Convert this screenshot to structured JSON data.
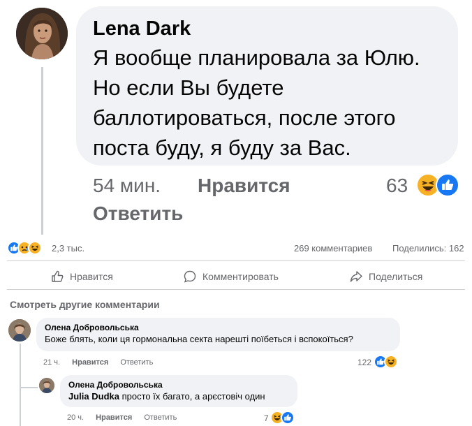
{
  "top_comment": {
    "author": "Lena Dark",
    "text": "Я вообще планировала за Юлю. Но если Вы будете баллотироваться, после этого поста буду, я буду за Вас.",
    "time": "54 мин.",
    "like_label": "Нравится",
    "reply_label": "Ответить",
    "reaction_count": "63",
    "reactions": [
      "haha-icon",
      "like-icon"
    ]
  },
  "post_summary": {
    "reaction_count": "2,3 тыс.",
    "comments": "269 комментариев",
    "shares": "Поделились: 162",
    "reactions": [
      "like-icon",
      "sad-icon",
      "haha-icon"
    ]
  },
  "actions": {
    "like": "Нравится",
    "comment": "Комментировать",
    "share": "Поделиться"
  },
  "view_more": "Смотреть другие комментарии",
  "comments": [
    {
      "author": "Олена Добровольська",
      "text": "Боже блять, коли ця гормональна секта нарешті поїбеться і вспокоїться?",
      "time": "21 ч.",
      "like_label": "Нравится",
      "reply_label": "Ответить",
      "reaction_count": "122",
      "reactions": [
        "like-icon",
        "haha-icon"
      ]
    },
    {
      "author": "Олена Добровольська",
      "mention": "Julia Dudka",
      "text": " просто їх багато, а арєстовіч один",
      "time": "20 ч.",
      "like_label": "Нравится",
      "reply_label": "Ответить",
      "reaction_count": "7",
      "reactions": [
        "haha-icon",
        "like-icon"
      ]
    }
  ],
  "colors": {
    "bubble": "#f0f2f5",
    "secondary_text": "#65676b",
    "like_blue": "#1877f2",
    "emoji_yellow": "#f7b125",
    "divider": "#ced0d4"
  }
}
